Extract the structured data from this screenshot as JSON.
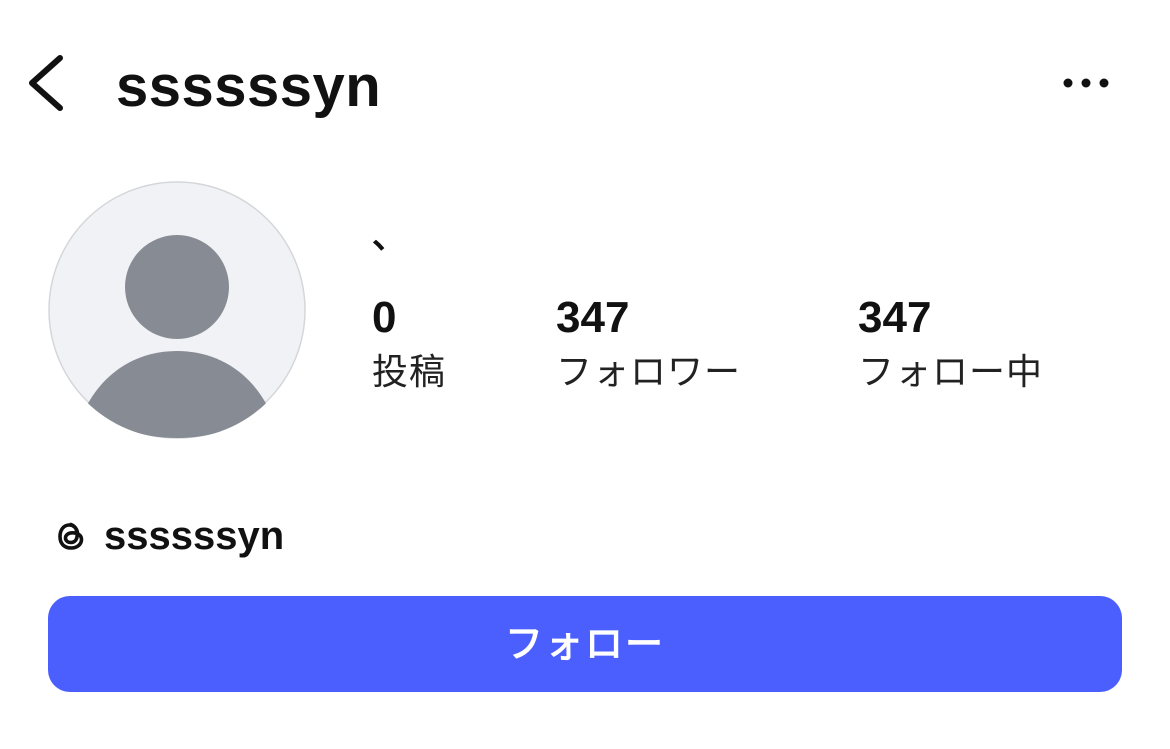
{
  "header": {
    "username": "ssssssyn",
    "back_icon": "chevron-left-icon",
    "more_icon": "more-horizontal-icon"
  },
  "profile": {
    "avatar_icon": "default-avatar-icon",
    "display_name": "、",
    "stats": [
      {
        "value": "0",
        "label": "投稿"
      },
      {
        "value": "347",
        "label": "フォロワー"
      },
      {
        "value": "347",
        "label": "フォロー中"
      }
    ]
  },
  "threads": {
    "icon": "threads-icon",
    "username": "ssssssyn"
  },
  "follow_button": {
    "label": "フォロー"
  },
  "colors": {
    "accent": "#4a5ffe",
    "avatar_bg": "#f0f2f5",
    "avatar_fg": "#878b94",
    "text": "#111111"
  }
}
